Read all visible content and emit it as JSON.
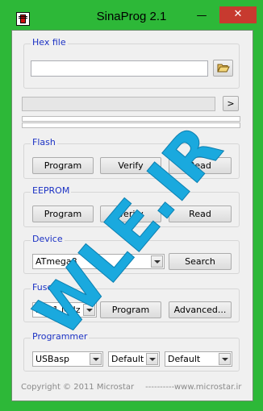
{
  "window": {
    "title": "SinaProg 2.1",
    "minimize_glyph": "—",
    "maximize_glyph": "□",
    "close_glyph": "✕"
  },
  "hex_file": {
    "label": "Hex file",
    "value": "",
    "browse_icon": "folder-open-icon"
  },
  "status": {
    "arrow_label": ">",
    "progress_top": 0,
    "progress_bottom": 0
  },
  "flash": {
    "label": "Flash",
    "program": "Program",
    "verify": "Verify",
    "read": "Read"
  },
  "eeprom": {
    "label": "EEPROM",
    "program": "Program",
    "verify": "Verify",
    "read": "Read"
  },
  "device": {
    "label": "Device",
    "selected": "ATmega8",
    "search": "Search"
  },
  "fuses": {
    "label": "Fuses",
    "selected": "Int. 1 MHz",
    "program": "Program",
    "advanced": "Advanced..."
  },
  "programmer": {
    "label": "Programmer",
    "selected": "USBasp",
    "port": "Default",
    "speed": "Default"
  },
  "footer": {
    "copyright": "Copyright © 2011 Microstar",
    "dashes": "----------",
    "website": "www.microstar.ir"
  },
  "watermark": "WLE.IR",
  "colors": {
    "frame": "#2db838",
    "group_label": "#1c32c4",
    "close_button": "#c73a2f",
    "watermark": "#1aa9de"
  }
}
